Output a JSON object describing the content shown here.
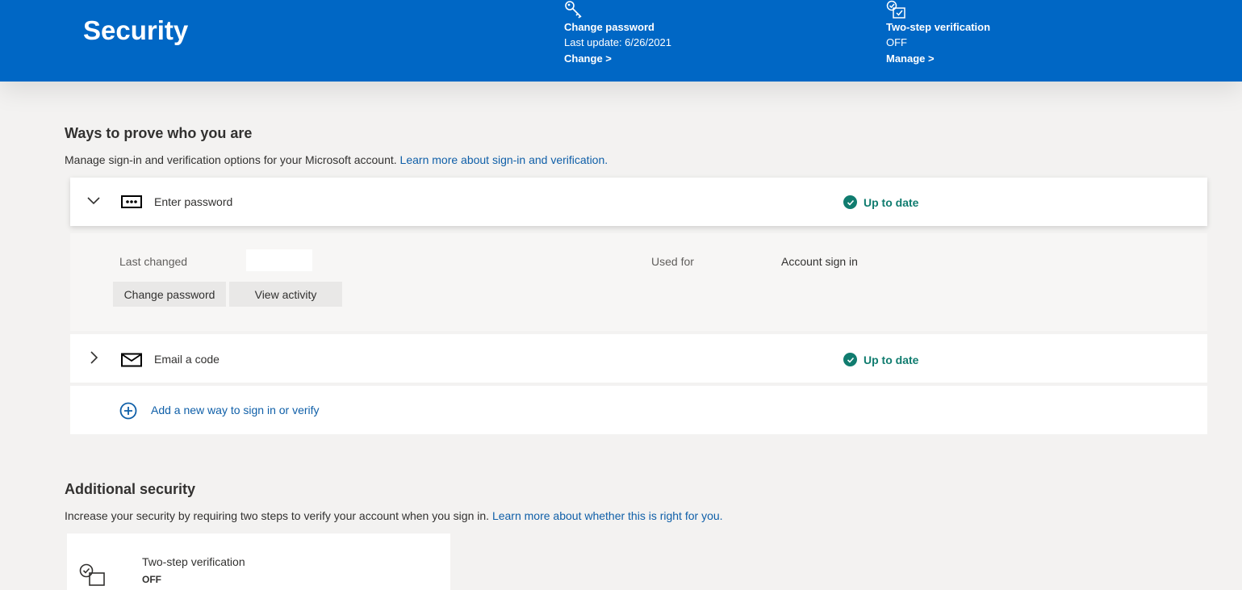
{
  "header": {
    "title": "Security",
    "change_password": {
      "title": "Change password",
      "subtitle": "Last update: 6/26/2021",
      "link": "Change >",
      "icon": "key-icon"
    },
    "two_step": {
      "title": "Two-step verification",
      "subtitle": "OFF",
      "link": "Manage >",
      "icon": "checklist-icon"
    }
  },
  "ways": {
    "title": "Ways to prove who you are",
    "desc": "Manage sign-in and verification options for your Microsoft account.",
    "desc_link": "Learn more about sign-in and verification.",
    "methods": [
      {
        "label": "Enter password",
        "status": "Up to date",
        "icon": "password-dots-icon"
      },
      {
        "label": "Email a code",
        "status": "Up to date",
        "icon": "envelope-icon"
      }
    ],
    "details": {
      "last_changed_label": "Last changed",
      "used_for_label": "Used for",
      "used_for_value": "Account sign in",
      "change_password_btn": "Change password",
      "view_activity_btn": "View activity"
    },
    "add_new": "Add a new way to sign in or verify"
  },
  "additional": {
    "title": "Additional security",
    "desc": "Increase your security by requiring two steps to verify your account when you sign in.",
    "desc_link": "Learn more about whether this is right for you.",
    "card": {
      "title": "Two-step verification",
      "status": "OFF"
    }
  },
  "colors": {
    "brand_blue": "#0067c5",
    "status_green": "#107c6f",
    "link_blue": "#0f5fa8",
    "page_bg": "#f3f2f1"
  }
}
